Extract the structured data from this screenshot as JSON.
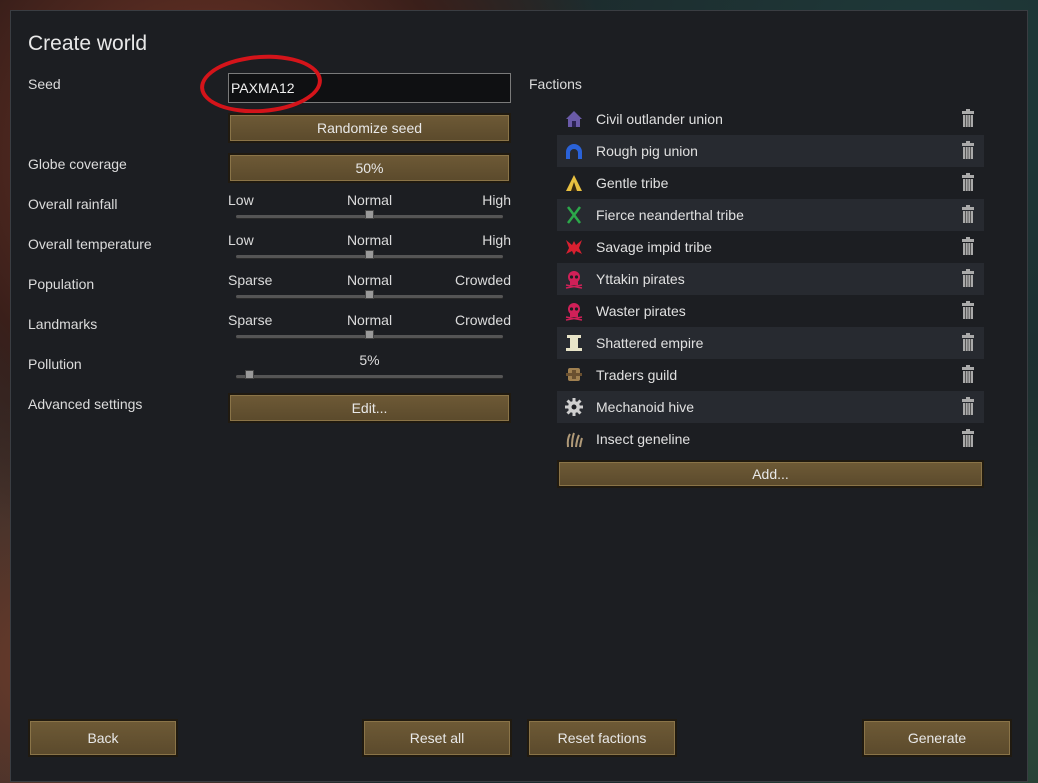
{
  "window": {
    "title": "Create world"
  },
  "seed": {
    "label": "Seed",
    "value": "PAXMA12",
    "randomize_label": "Randomize seed"
  },
  "globe": {
    "label": "Globe coverage",
    "value": "50%"
  },
  "rainfall": {
    "label": "Overall rainfall",
    "low": "Low",
    "mid": "Normal",
    "high": "High",
    "level": 0.5
  },
  "temperature": {
    "label": "Overall temperature",
    "low": "Low",
    "mid": "Normal",
    "high": "High",
    "level": 0.5
  },
  "population": {
    "label": "Population",
    "low": "Sparse",
    "mid": "Normal",
    "high": "Crowded",
    "level": 0.5
  },
  "landmarks": {
    "label": "Landmarks",
    "low": "Sparse",
    "mid": "Normal",
    "high": "Crowded",
    "level": 0.5
  },
  "pollution": {
    "label": "Pollution",
    "value": "5%",
    "level": 0.05
  },
  "advanced": {
    "label": "Advanced settings",
    "button": "Edit..."
  },
  "factions": {
    "title": "Factions",
    "items": [
      {
        "name": "Civil outlander union",
        "icon": "house-icon",
        "color": "#6a5aa8"
      },
      {
        "name": "Rough pig union",
        "icon": "dome-icon",
        "color": "#2a62d8"
      },
      {
        "name": "Gentle tribe",
        "icon": "tent-icon",
        "color": "#e8c040"
      },
      {
        "name": "Fierce neanderthal tribe",
        "icon": "crossed-spears-icon",
        "color": "#2ca84a"
      },
      {
        "name": "Savage impid tribe",
        "icon": "impid-icon",
        "color": "#d82030"
      },
      {
        "name": "Yttakin pirates",
        "icon": "skull-icon",
        "color": "#d02058"
      },
      {
        "name": "Waster pirates",
        "icon": "skull-icon",
        "color": "#d02058"
      },
      {
        "name": "Shattered empire",
        "icon": "column-icon",
        "color": "#e8e4c8"
      },
      {
        "name": "Traders guild",
        "icon": "caravan-icon",
        "color": "#a08050"
      },
      {
        "name": "Mechanoid hive",
        "icon": "gear-icon",
        "color": "#cfcfcf"
      },
      {
        "name": "Insect geneline",
        "icon": "claws-icon",
        "color": "#b09a78"
      }
    ],
    "add_label": "Add..."
  },
  "footer": {
    "back": "Back",
    "reset_all": "Reset all",
    "reset_factions": "Reset factions",
    "generate": "Generate"
  },
  "colors": {
    "button": "#6e5a36",
    "window_bg": "#1c1e22",
    "highlight_ring": "#d4141a"
  }
}
